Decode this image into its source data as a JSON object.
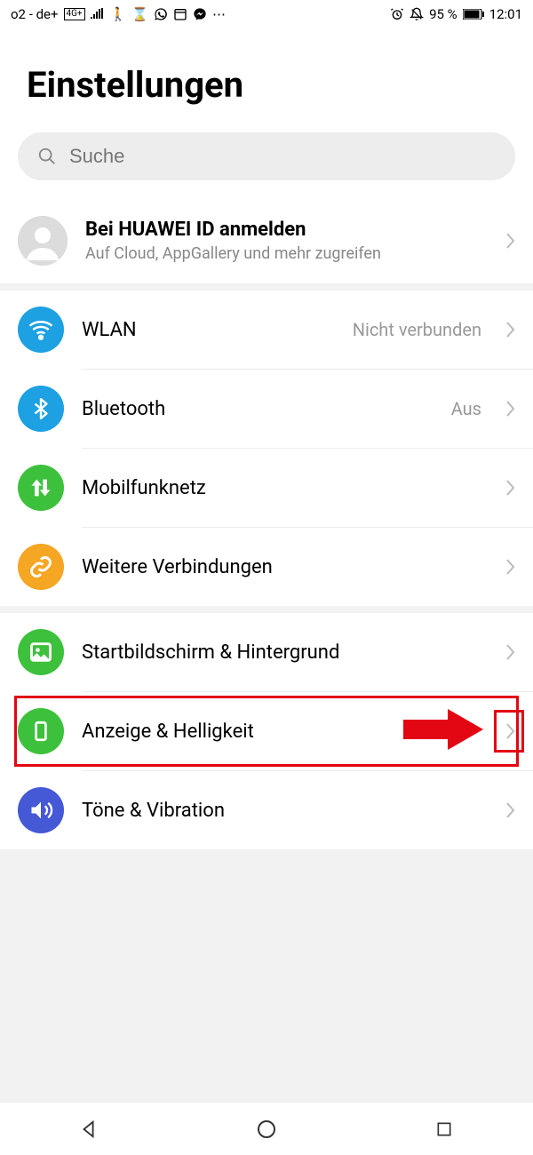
{
  "status": {
    "carrier": "o2 - de+",
    "network_badge": "4G+",
    "battery_pct": "95 %",
    "time": "12:01"
  },
  "page_title": "Einstellungen",
  "search": {
    "placeholder": "Suche"
  },
  "account": {
    "title": "Bei HUAWEI ID anmelden",
    "subtitle": "Auf Cloud, AppGallery und mehr zugreifen"
  },
  "group1": {
    "wlan": {
      "label": "WLAN",
      "value": "Nicht verbunden"
    },
    "bt": {
      "label": "Bluetooth",
      "value": "Aus"
    },
    "mobile": {
      "label": "Mobilfunknetz"
    },
    "more_conn": {
      "label": "Weitere Verbindungen"
    }
  },
  "group2": {
    "home": {
      "label": "Startbildschirm & Hintergrund"
    },
    "display": {
      "label": "Anzeige & Helligkeit"
    },
    "sound": {
      "label": "Töne & Vibration"
    }
  }
}
